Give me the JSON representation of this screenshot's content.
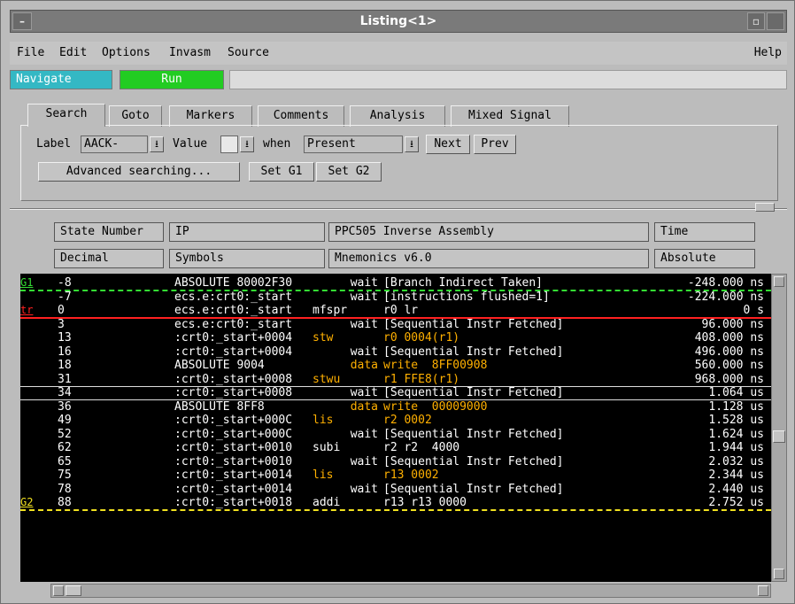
{
  "window": {
    "title": "Listing<1>",
    "minimize_glyph": "–",
    "restore_glyph": "▫"
  },
  "menu": {
    "file": "File",
    "edit": "Edit",
    "options": "Options",
    "invasm": "Invasm",
    "source": "Source",
    "help": "Help"
  },
  "nav": {
    "navigate": "Navigate",
    "run": "Run"
  },
  "tabs": [
    "Search",
    "Goto",
    "Markers",
    "Comments",
    "Analysis",
    "Mixed Signal"
  ],
  "search": {
    "label_text": "Label",
    "label_value": "AACK-",
    "value_text": "Value",
    "value_value": "",
    "when_text": "when",
    "when_value": "Present",
    "next": "Next",
    "prev": "Prev",
    "advanced": "Advanced searching...",
    "set_g1": "Set G1",
    "set_g2": "Set G2",
    "dropdown_glyph": "⭳"
  },
  "columns": {
    "state_number": "State Number",
    "state_format": "Decimal",
    "ip": "IP",
    "ip_format": "Symbols",
    "asm": "PPC505 Inverse Assembly",
    "asm_format": "Mnemonics v6.0",
    "time": "Time",
    "time_format": "Absolute"
  },
  "markers": {
    "g1": "G1",
    "trigger": "tr",
    "g2": "G2"
  },
  "colors": {
    "listing_bg": "#000000",
    "text": "#ffffff",
    "highlight": "#ffb000",
    "g1_line": "#33dd33",
    "trigger_line": "#ff2020",
    "g2_line": "#f0e020",
    "navigate_bg": "#34b8c4",
    "run_bg": "#22cc22"
  },
  "rows": [
    {
      "state": "-8",
      "ip": "ABSOLUTE 80002F30",
      "mn": "wait",
      "ops": "[Branch Indirect Taken]",
      "time": "-248.000 ns",
      "hl": false,
      "marker": "g1"
    },
    {
      "state": "-7",
      "ip": "ecs.e:crt0:_start",
      "mn": "wait",
      "ops": "[instructions flushed=1]",
      "time": "-224.000 ns",
      "hl": false,
      "marker": ""
    },
    {
      "state": "0",
      "ip": "ecs.e:crt0:_start",
      "mn": "mfspr",
      "ops": "r0 lr",
      "time": "0 s",
      "hl": false,
      "marker": "tr"
    },
    {
      "state": "3",
      "ip": "ecs.e:crt0:_start",
      "mn": "wait",
      "ops": "[Sequential Instr Fetched]",
      "time": "96.000 ns",
      "hl": false,
      "marker": ""
    },
    {
      "state": "13",
      "ip": ":crt0:_start+0004",
      "mn": "stw",
      "ops": "r0 0004(r1)",
      "time": "408.000 ns",
      "hl": true,
      "marker": ""
    },
    {
      "state": "16",
      "ip": ":crt0:_start+0004",
      "mn": "wait",
      "ops": "[Sequential Instr Fetched]",
      "time": "496.000 ns",
      "hl": false,
      "marker": ""
    },
    {
      "state": "18",
      "ip": "ABSOLUTE 9004",
      "mn": "data",
      "ops": "write  8FF00908",
      "time": "560.000 ns",
      "hl": true,
      "marker": ""
    },
    {
      "state": "31",
      "ip": ":crt0:_start+0008",
      "mn": "stwu",
      "ops": "r1 FFE8(r1)",
      "time": "968.000 ns",
      "hl": true,
      "marker": ""
    },
    {
      "state": "34",
      "ip": ":crt0:_start+0008",
      "mn": "wait",
      "ops": "[Sequential Instr Fetched]",
      "time": "1.064 us",
      "hl": false,
      "marker": ""
    },
    {
      "state": "36",
      "ip": "ABSOLUTE 8FF8",
      "mn": "data",
      "ops": "write  00009000",
      "time": "1.128 us",
      "hl": true,
      "marker": ""
    },
    {
      "state": "49",
      "ip": ":crt0:_start+000C",
      "mn": "lis",
      "ops": "r2 0002",
      "time": "1.528 us",
      "hl": true,
      "marker": ""
    },
    {
      "state": "52",
      "ip": ":crt0:_start+000C",
      "mn": "wait",
      "ops": "[Sequential Instr Fetched]",
      "time": "1.624 us",
      "hl": false,
      "marker": ""
    },
    {
      "state": "62",
      "ip": ":crt0:_start+0010",
      "mn": "subi",
      "ops": "r2 r2  4000",
      "time": "1.944 us",
      "hl": false,
      "marker": ""
    },
    {
      "state": "65",
      "ip": ":crt0:_start+0010",
      "mn": "wait",
      "ops": "[Sequential Instr Fetched]",
      "time": "2.032 us",
      "hl": false,
      "marker": ""
    },
    {
      "state": "75",
      "ip": ":crt0:_start+0014",
      "mn": "lis",
      "ops": "r13 0002",
      "time": "2.344 us",
      "hl": true,
      "marker": ""
    },
    {
      "state": "78",
      "ip": ":crt0:_start+0014",
      "mn": "wait",
      "ops": "[Sequential Instr Fetched]",
      "time": "2.440 us",
      "hl": false,
      "marker": ""
    },
    {
      "state": "88",
      "ip": ":crt0:_start+0018",
      "mn": "addi",
      "ops": "r13 r13 0000",
      "time": "2.752 us",
      "hl": false,
      "marker": "g2"
    }
  ]
}
